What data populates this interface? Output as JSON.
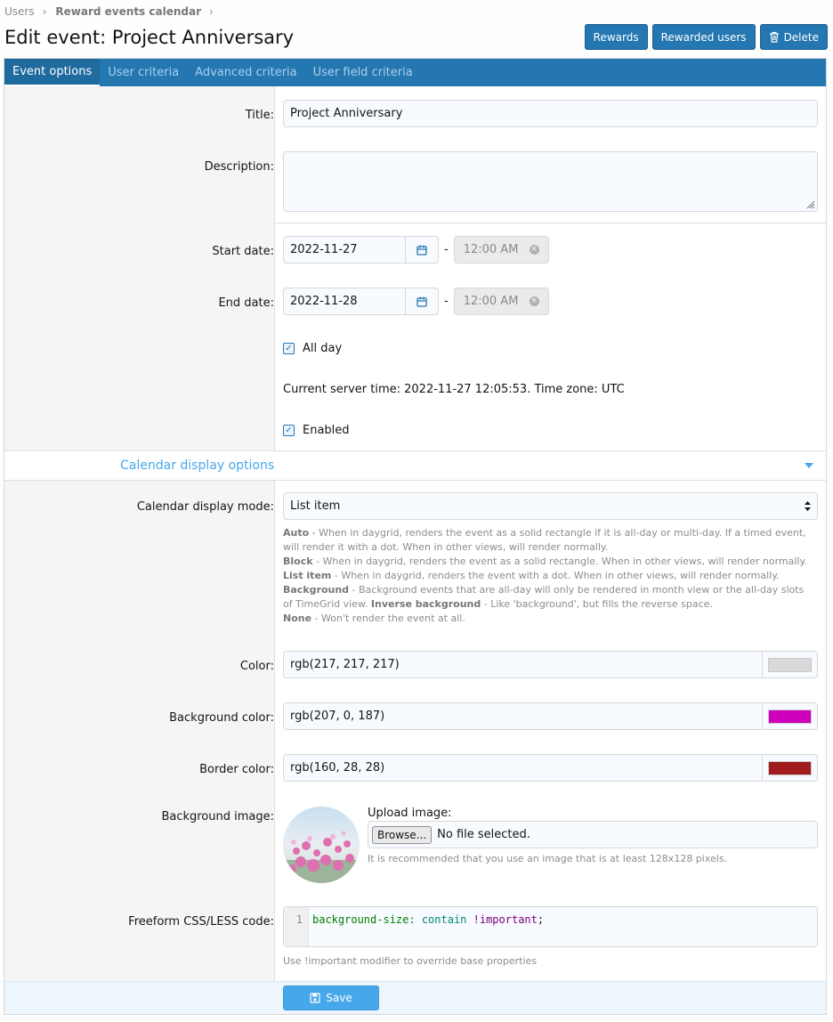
{
  "breadcrumb": {
    "items": [
      "Users",
      "Reward events calendar"
    ]
  },
  "page": {
    "title": "Edit event: Project Anniversary"
  },
  "actions": {
    "rewards": "Rewards",
    "rewarded_users": "Rewarded users",
    "delete": "Delete"
  },
  "tabs": [
    {
      "label": "Event options",
      "active": true
    },
    {
      "label": "User criteria"
    },
    {
      "label": "Advanced criteria"
    },
    {
      "label": "User field criteria"
    }
  ],
  "form": {
    "title_label": "Title:",
    "title_value": "Project Anniversary",
    "description_label": "Description:",
    "description_value": "",
    "start_label": "Start date:",
    "start_date": "2022-11-27",
    "start_time": "12:00 AM",
    "end_label": "End date:",
    "end_date": "2022-11-28",
    "end_time": "12:00 AM",
    "dash": "-",
    "all_day_label": "All day",
    "server_time": "Current server time: 2022-11-27 12:05:53. Time zone: UTC",
    "enabled_label": "Enabled"
  },
  "display_section": {
    "title": "Calendar display options",
    "mode_label": "Calendar display mode:",
    "mode_value": "List item",
    "help": {
      "auto_term": "Auto",
      "auto_text": " - When in daygrid, renders the event as a solid rectangle if it is all-day or multi-day. If a timed event, will render it with a dot. When in other views, will render normally.",
      "block_term": "Block",
      "block_text": " - When in daygrid, renders the event as a solid rectangle. When in other views, will render normally.",
      "list_term": "List item",
      "list_text": " - When in daygrid, renders the event with a dot. When in other views, will render normally.",
      "bg_term": "Background",
      "bg_text": " - Background events that are all-day will only be rendered in month view or the all-day slots of TimeGrid view. ",
      "inv_term": "Inverse background",
      "inv_text": " - Like 'background', but fills the reverse space.",
      "none_term": "None",
      "none_text": " - Won't render the event at all."
    },
    "color_label": "Color:",
    "color_value": "rgb(217, 217, 217)",
    "color_hex": "#d9d9d9",
    "bg_color_label": "Background color:",
    "bg_color_value": "rgb(207, 0, 187)",
    "bg_color_hex": "#cf00bb",
    "border_color_label": "Border color:",
    "border_color_value": "rgb(160, 28, 28)",
    "border_color_hex": "#a01c1c",
    "bg_image_label": "Background image:",
    "upload_label": "Upload image:",
    "browse_label": "Browse...",
    "no_file": "No file selected.",
    "image_hint": "It is recommended that you use an image that is at least 128x128 pixels.",
    "css_label": "Freeform CSS/LESS code:",
    "code_line_no": "1",
    "code_prop": "background-size:",
    "code_val": " contain ",
    "code_imp": "!important",
    "code_end": ";",
    "css_hint": "Use !important modifier to override base properties"
  },
  "footer": {
    "save": "Save"
  }
}
